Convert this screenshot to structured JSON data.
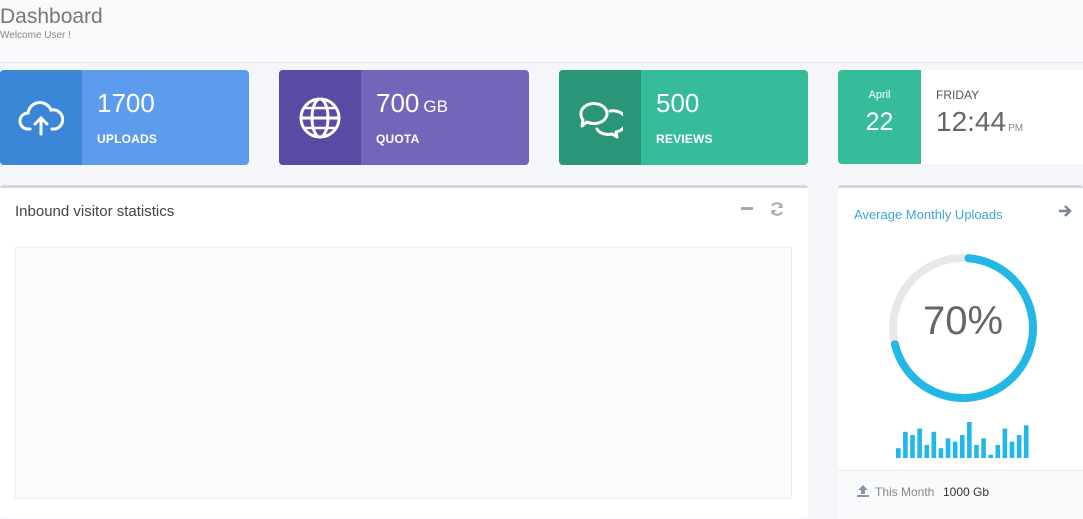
{
  "header": {
    "title": "Dashboard",
    "subtitle": "Welcome User !"
  },
  "stats": [
    {
      "value": "1700",
      "unit": "",
      "label": "UPLOADS",
      "icon": "cloud-upload-icon",
      "icon_bg": "#3b86d6",
      "bg": "#5d9cec"
    },
    {
      "value": "700",
      "unit": "GB",
      "label": "QUOTA",
      "icon": "globe-icon",
      "icon_bg": "#5a4aa4",
      "bg": "#7266ba"
    },
    {
      "value": "500",
      "unit": "",
      "label": "REVIEWS",
      "icon": "chat-icon",
      "icon_bg": "#2b957a",
      "bg": "#37bc9b"
    }
  ],
  "date_card": {
    "month": "April",
    "day": "22",
    "weekday": "FRIDAY",
    "time": "12:44",
    "ampm": "PM",
    "accent": "#37bc9b"
  },
  "main_panel": {
    "title": "Inbound visitor statistics",
    "tools": [
      "minimize-icon",
      "refresh-icon"
    ]
  },
  "side_panel": {
    "title": "Average Monthly Uploads",
    "percent_label": "70%",
    "percent": 0.7,
    "accent": "#23b7e5",
    "sparkline": [
      3,
      8,
      7,
      9,
      4,
      8,
      3,
      6,
      5,
      7,
      11,
      4,
      6,
      1,
      4,
      9,
      5,
      7,
      10
    ],
    "footer_label": "This Month",
    "footer_value": "1000 Gb"
  }
}
